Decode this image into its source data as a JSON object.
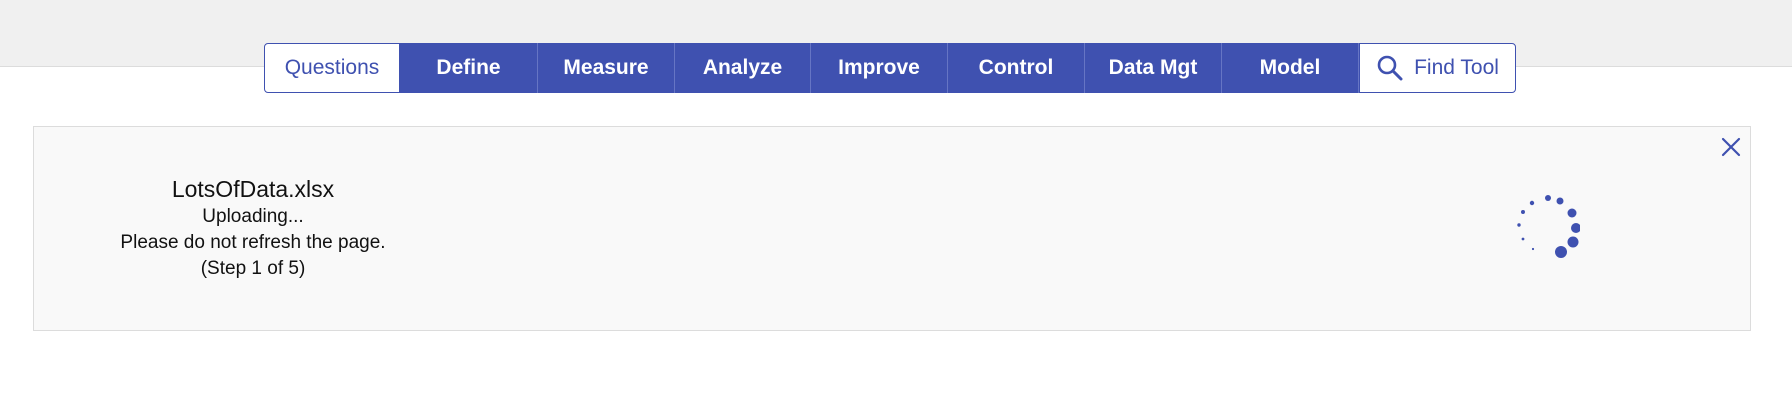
{
  "nav": {
    "tabs": [
      {
        "label": "Questions",
        "name": "tab-questions"
      },
      {
        "label": "Define",
        "name": "tab-define"
      },
      {
        "label": "Measure",
        "name": "tab-measure"
      },
      {
        "label": "Analyze",
        "name": "tab-analyze"
      },
      {
        "label": "Improve",
        "name": "tab-improve"
      },
      {
        "label": "Control",
        "name": "tab-control"
      },
      {
        "label": "Data Mgt",
        "name": "tab-data-mgt"
      },
      {
        "label": "Model",
        "name": "tab-model"
      }
    ],
    "find_tool": {
      "label": "Find Tool",
      "icon": "search-icon"
    }
  },
  "upload": {
    "filename": "LotsOfData.xlsx",
    "status": "Uploading...",
    "warning": "Please do not refresh the page.",
    "step": "(Step 1 of 5)",
    "close_icon": "close-icon",
    "spinner_icon": "loading-spinner-icon"
  },
  "colors": {
    "accent": "#3f51b0",
    "header_band": "#f0f0f0",
    "panel_bg": "#f9f9f9",
    "panel_border": "#dcdcdc"
  }
}
